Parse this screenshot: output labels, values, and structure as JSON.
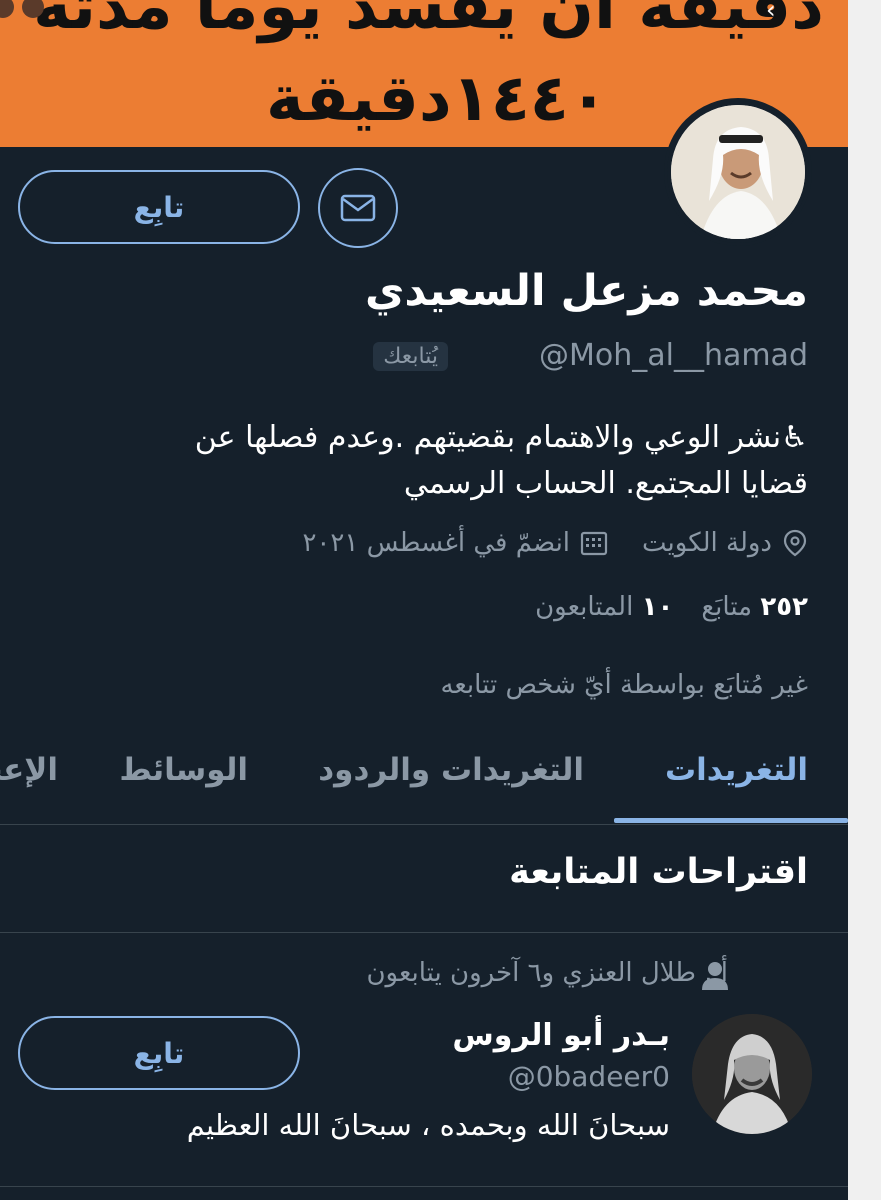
{
  "banner": {
    "line1": "دقيقه ان يفسد يوما مدته",
    "line2": "١٤٤٠دقيقة"
  },
  "profile": {
    "display_name": "محمد مزعل السعيدي",
    "handle": "@Moh_al__hamad",
    "follows_you": "يُتابعك",
    "bio_line1": "♿نشر الوعي والاهتمام بقضيتهم .وعدم فصلها عن",
    "bio_line2": "قضايا المجتمع. الحساب الرسمي",
    "location": "دولة الكويت",
    "joined": "انضمّ في أغسطس ٢٠٢١",
    "following_count": "٢٥٢",
    "following_label": "متابَع",
    "followers_count": "١٠",
    "followers_label": "المتابعون",
    "not_followed_text": "غير مُتابَع بواسطة أيّ شخص تتابعه",
    "follow_label": "تابِع"
  },
  "tabs": [
    {
      "label": "التغريدات",
      "active": true
    },
    {
      "label": "التغريدات والردود",
      "active": false
    },
    {
      "label": "الوسائط",
      "active": false
    },
    {
      "label": "الإعجابات",
      "active": false
    }
  ],
  "suggestions": {
    "title": "اقتراحات المتابعة",
    "social_context": "أ . طلال العنزي و٦ آخرون يتابعون",
    "name": "بـدر أبو الروس",
    "handle": "@0badeer0",
    "bio": "سبحانَ الله وبحمده ، سبحانَ الله العظيم",
    "follow_label": "تابِع"
  },
  "colors": {
    "background": "#15202b",
    "accent": "#8ab4e6",
    "banner": "#ec7d33",
    "secondary_text": "#8b98a5"
  }
}
